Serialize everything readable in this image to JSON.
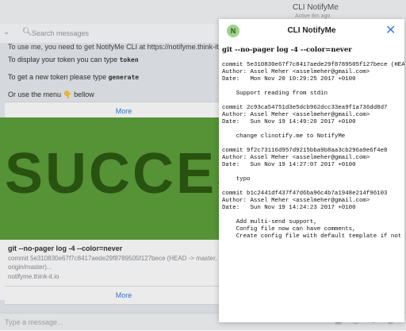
{
  "chat": {
    "title": "CLI NotifyMe",
    "status": "Active 8m ago",
    "search_placeholder": "Search messages",
    "messages": {
      "line0": "To use me, you need to get NotifyMe CLI at https://notifyme.think-it.io",
      "line1_prefix": "To display your token you can type ",
      "line1_code": "token",
      "line2_prefix": "To get a new token please type ",
      "line2_code": "generate",
      "line3": "Or use the menu 👇 bellow"
    },
    "more_label": "More",
    "preview": {
      "image_text": "SUCCESS",
      "title": "git --no-pager log -4 --color=never",
      "description": "commit 5e310830e67f7c8417aede29f8789505f127bece (HEAD -> master, origin/master)...",
      "site": "notifyme.think-it.io"
    },
    "input_placeholder": "Type a message..."
  },
  "modal": {
    "avatar_letter": "N",
    "title": "CLI NotifyMe",
    "command": "git --no-pager log -4 --color=never",
    "output": "commit 5e310830e67f7c8417aede29f8789505f127bece (HEAD -> master, origin/master)\nAuthor: Assel Meher <asselmeher@gmail.com>\nDate:   Mon Nov 20 10:29:25 2017 +0100\n\n    Support reading from stdin\n\ncommit 2c93ca54751d3e5dcb962dcc33ea9f1a736dd8d7\nAuthor: Assel Meher <asselmeher@gmail.com>\nDate:   Sun Nov 19 14:49:20 2017 +0100\n\n    change clinotify.me to NotifyMe\n\ncommit 9f2c73116d957d9215bba9b8aa3cb296a9e6f4e8\nAuthor: Assel Meher <asselmeher@gmail.com>\nDate:   Sun Nov 19 14:27:07 2017 +0100\n\n    typo\n\ncommit b1c2441df437f47d6ba96c4b7a1948e214f96103\nAuthor: Assel Meher <asselmeher@gmail.com>\nDate:   Sun Nov 19 14:24:23 2017 +0100\n\n    Add multi-send support,\n    Config file now can have comments,\n    Create config file with default template if not exists"
  },
  "colors": {
    "accent": "#3b82e0",
    "success_bg": "#5e9f3b",
    "avatar_bg": "#9fd28a"
  }
}
